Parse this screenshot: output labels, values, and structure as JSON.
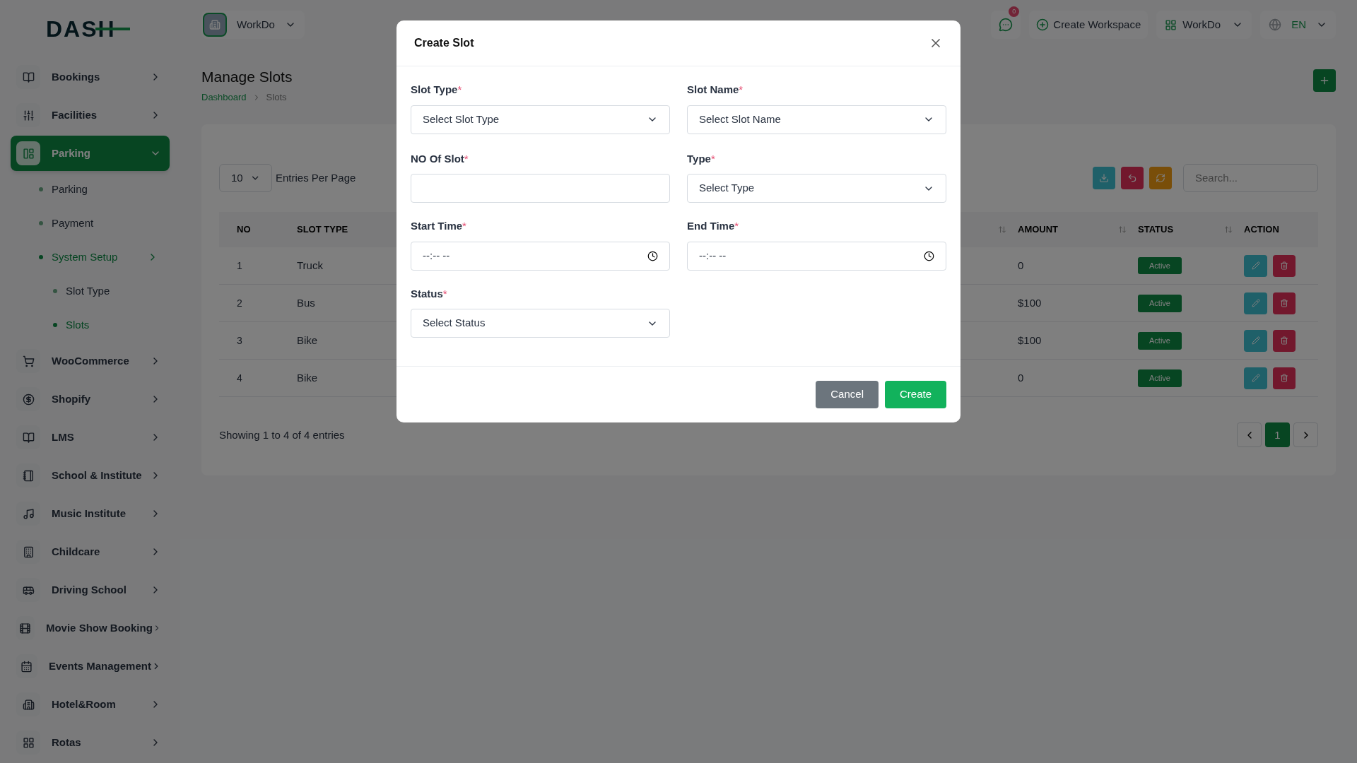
{
  "logo": "DASH",
  "sidebar": {
    "items": [
      {
        "label": "Bookings",
        "selected": false
      },
      {
        "label": "Facilities",
        "selected": false
      },
      {
        "label": "Parking",
        "selected": true,
        "children": [
          {
            "label": "Parking",
            "selected": false
          },
          {
            "label": "Payment",
            "selected": false
          },
          {
            "label": "System Setup",
            "selected": true,
            "children": [
              {
                "label": "Slot Type",
                "selected": false
              },
              {
                "label": "Slots",
                "selected": true
              }
            ]
          }
        ]
      },
      {
        "label": "WooCommerce",
        "selected": false
      },
      {
        "label": "Shopify",
        "selected": false
      },
      {
        "label": "LMS",
        "selected": false
      },
      {
        "label": "School & Institute",
        "selected": false
      },
      {
        "label": "Music Institute",
        "selected": false
      },
      {
        "label": "Childcare",
        "selected": false
      },
      {
        "label": "Driving School",
        "selected": false
      },
      {
        "label": "Movie Show Booking",
        "selected": false
      },
      {
        "label": "Events Management",
        "selected": false
      },
      {
        "label": "Hotel&Room",
        "selected": false
      },
      {
        "label": "Rotas",
        "selected": false
      }
    ]
  },
  "topbar": {
    "workspace": "WorkDo",
    "message_count": "0",
    "create_workspace": "Create Workspace",
    "apps": "WorkDo",
    "language": "EN"
  },
  "page": {
    "title": "Manage Slots",
    "breadcrumb": [
      "Dashboard",
      "Slots"
    ]
  },
  "table": {
    "entries": "10",
    "entries_label": "Entries Per Page",
    "search_placeholder": "Search...",
    "columns": [
      "NO",
      "SLOT TYPE",
      "AMOUNT",
      "STATUS",
      "ACTION"
    ],
    "rows": [
      {
        "no": "1",
        "slot_type": "Truck",
        "amount": "0",
        "status": "Active"
      },
      {
        "no": "2",
        "slot_type": "Bus",
        "amount": "$100",
        "status": "Active"
      },
      {
        "no": "3",
        "slot_type": "Bike",
        "amount": "$100",
        "status": "Active"
      },
      {
        "no": "4",
        "slot_type": "Bike",
        "amount": "0",
        "status": "Active"
      }
    ],
    "footer": "Showing 1 to 4 of 4 entries",
    "pages": [
      {
        "label": "1",
        "selected": true
      }
    ]
  },
  "modal": {
    "title": "Create Slot",
    "fields": [
      {
        "kind": "select",
        "label": "Slot Type",
        "marker": "*",
        "placeholder": "Select Slot Type"
      },
      {
        "kind": "select",
        "label": "Slot Name",
        "marker": "*",
        "placeholder": "Select Slot Name"
      },
      {
        "kind": "input",
        "label": "NO Of Slot",
        "marker": "*"
      },
      {
        "kind": "select",
        "label": "Type",
        "marker": "*",
        "placeholder": "Select Type"
      },
      {
        "kind": "time",
        "label": "Start Time",
        "marker": "*",
        "placeholder": "--:-- --"
      },
      {
        "kind": "time",
        "label": "End Time",
        "marker": "*",
        "placeholder": "--:-- --"
      },
      {
        "kind": "select",
        "label": "Status",
        "marker": "*",
        "placeholder": "Select Status"
      }
    ],
    "buttons": [
      {
        "label": "Cancel",
        "kind": "secondary"
      },
      {
        "label": "Create",
        "kind": "primary"
      }
    ]
  }
}
